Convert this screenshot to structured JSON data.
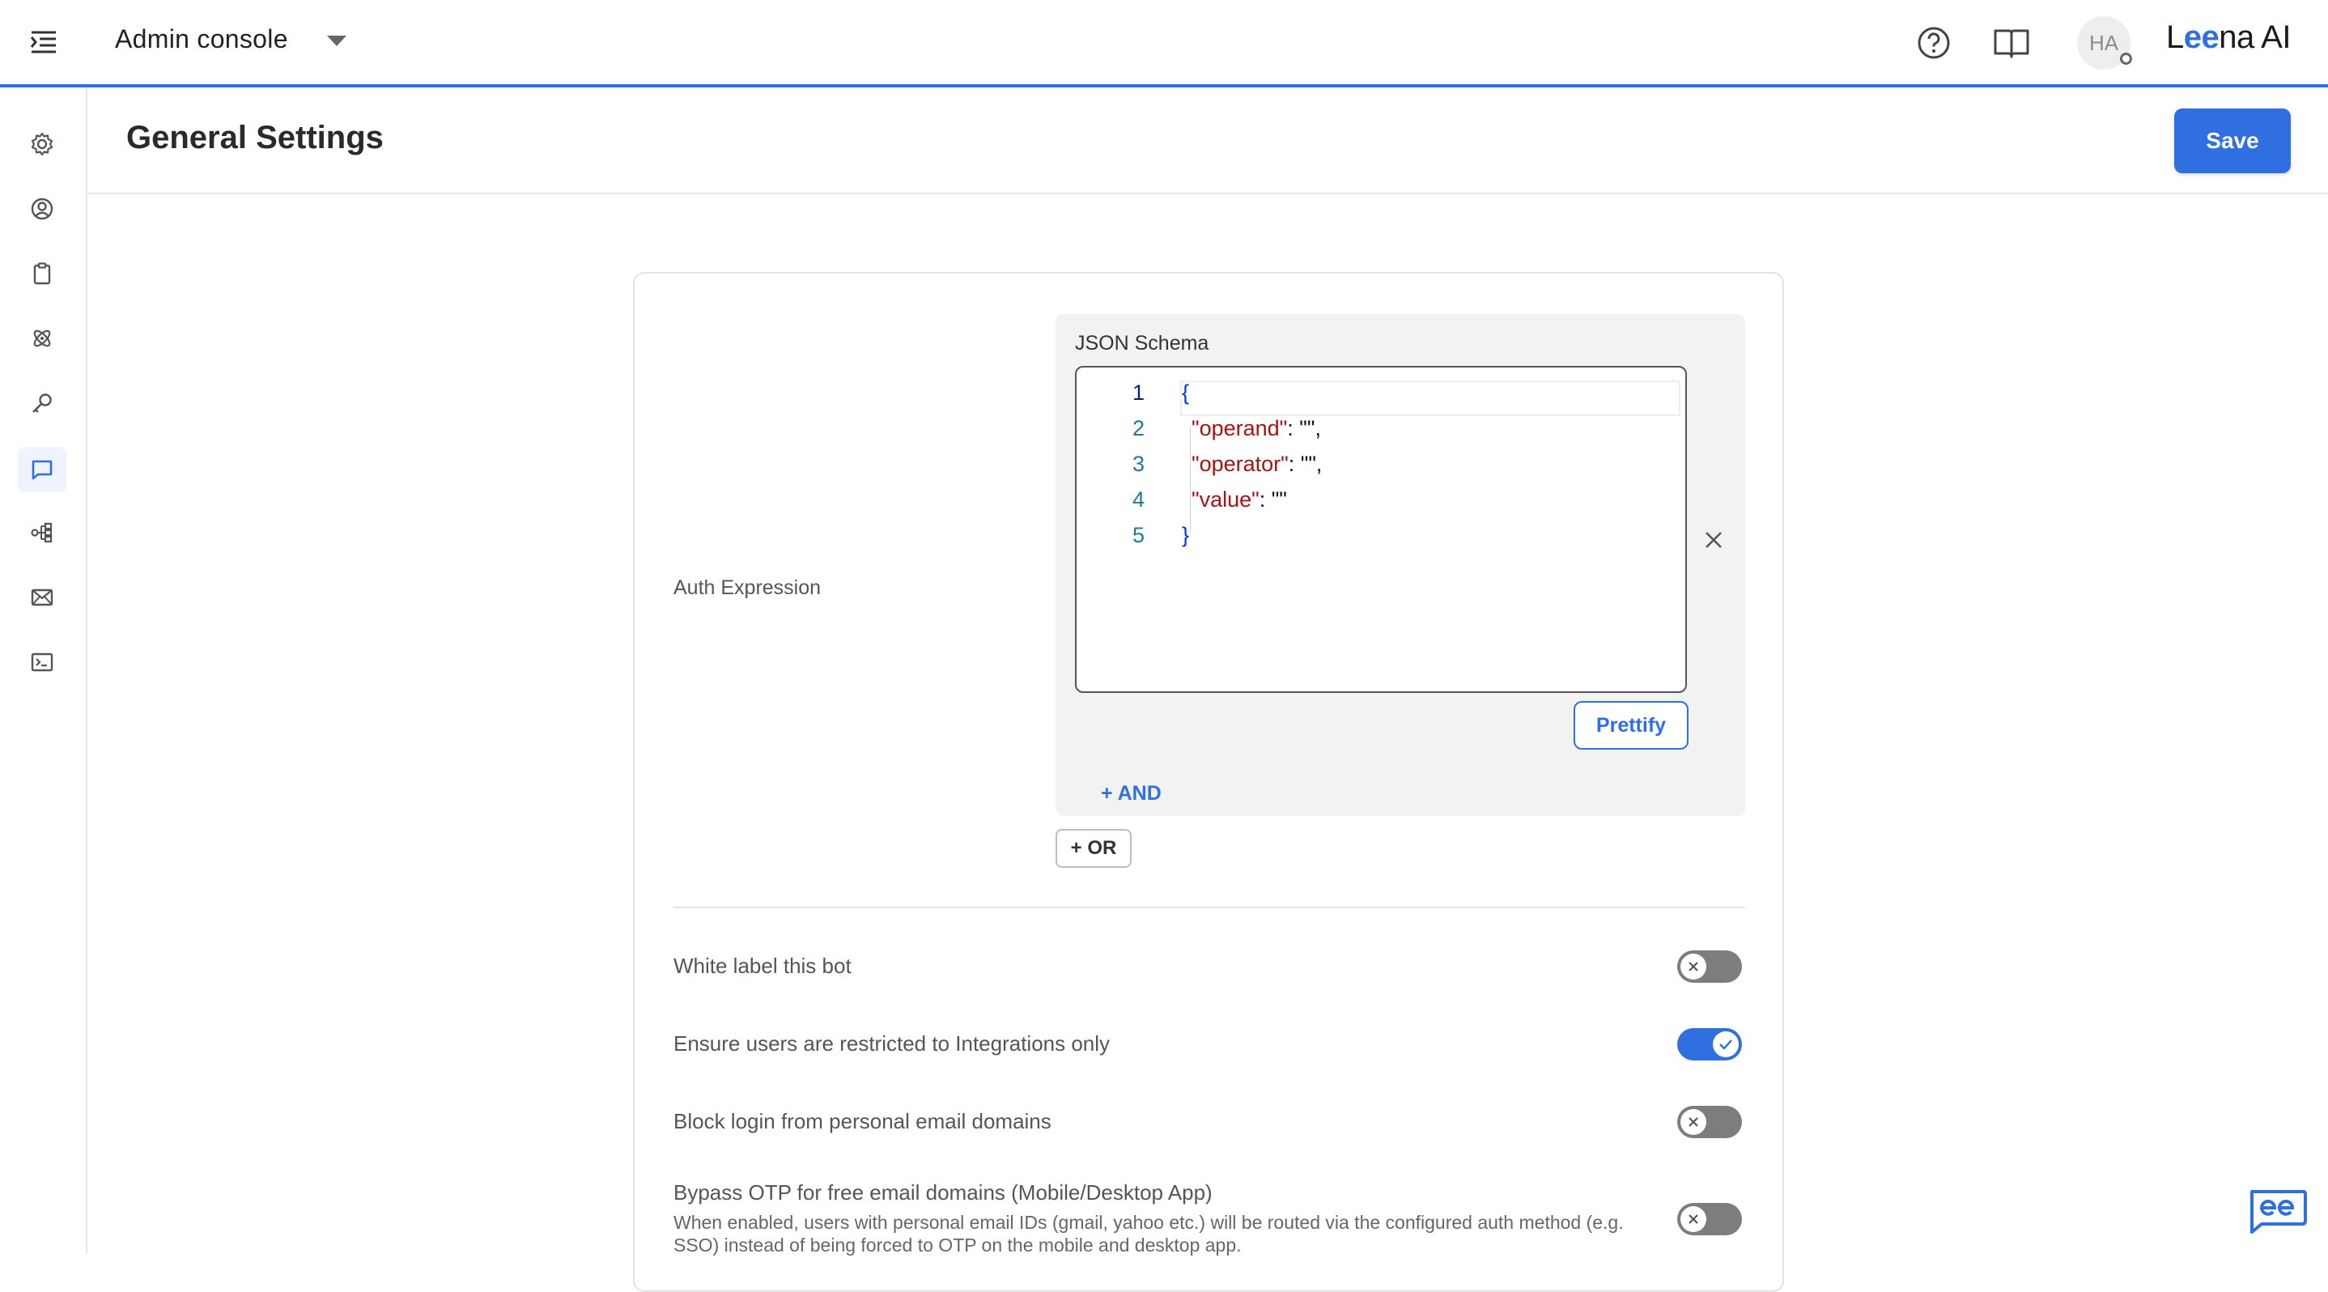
{
  "header": {
    "app_title": "Admin console",
    "avatar_initials": "HA",
    "brand_prefix": "L",
    "brand_ee": "ee",
    "brand_suffix": "na AI"
  },
  "page": {
    "title": "General Settings",
    "save_label": "Save"
  },
  "sidebar": {
    "items": [
      {
        "name": "settings",
        "icon": "gear-icon"
      },
      {
        "name": "users",
        "icon": "user-circle-icon"
      },
      {
        "name": "clipboard",
        "icon": "clipboard-icon"
      },
      {
        "name": "integrations",
        "icon": "atom-icon"
      },
      {
        "name": "keys",
        "icon": "key-icon"
      },
      {
        "name": "chat",
        "icon": "chat-icon",
        "active": true
      },
      {
        "name": "workflows",
        "icon": "flow-icon"
      },
      {
        "name": "email",
        "icon": "mail-icon"
      },
      {
        "name": "console",
        "icon": "terminal-icon"
      }
    ]
  },
  "auth": {
    "label": "Auth Expression",
    "schema_title": "JSON Schema",
    "code_lines": [
      {
        "no": "1",
        "text": "{"
      },
      {
        "no": "2",
        "key": "\"operand\"",
        "rest": ": \"\","
      },
      {
        "no": "3",
        "key": "\"operator\"",
        "rest": ": \"\","
      },
      {
        "no": "4",
        "key": "\"value\"",
        "rest": ": \"\""
      },
      {
        "no": "5",
        "text": "}"
      }
    ],
    "prettify_label": "Prettify",
    "and_label": "+ AND",
    "or_label": "+ OR"
  },
  "settings": [
    {
      "label": "White label this bot",
      "enabled": false
    },
    {
      "label": "Ensure users are restricted to Integrations only",
      "enabled": true
    },
    {
      "label": "Block login from personal email domains",
      "enabled": false
    },
    {
      "label": "Bypass OTP for free email domains (Mobile/Desktop App)",
      "description": "When enabled, users with personal email IDs (gmail, yahoo etc.) will be routed via the configured auth method (e.g. SSO) instead of being forced to OTP on the mobile and desktop app.",
      "enabled": false
    }
  ],
  "colors": {
    "accent": "#2f6fe0",
    "toggle_off": "#7d7d7d",
    "json_key": "#a31515",
    "json_brace": "#0431fa"
  }
}
